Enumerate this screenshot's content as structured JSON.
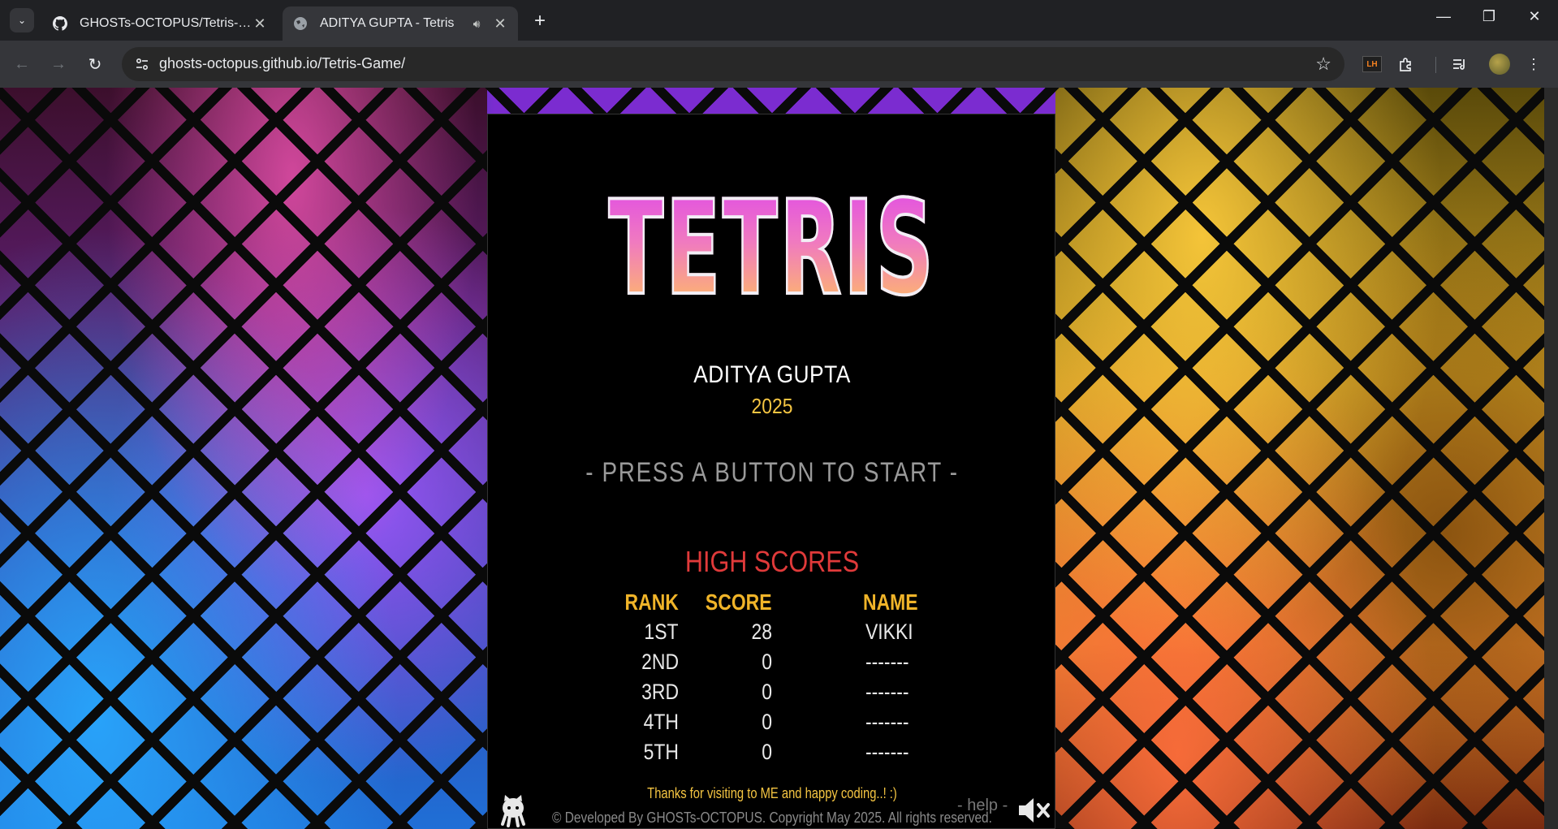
{
  "browser": {
    "tabs": [
      {
        "title": "GHOSTs-OCTOPUS/Tetris-Game",
        "favicon": "github-icon",
        "active": false
      },
      {
        "title": "ADITYA GUPTA - Tetris",
        "favicon": "globe-icon",
        "active": true,
        "audio": true
      }
    ],
    "url": "ghosts-octopus.github.io/Tetris-Game/",
    "lighthouse_label": "LH"
  },
  "game": {
    "title": "TETRIS",
    "author": "ADITYA GUPTA",
    "year": "2025",
    "prompt": "- PRESS A BUTTON TO START -",
    "high_scores": {
      "title": "HIGH SCORES",
      "headers": {
        "rank": "RANK",
        "score": "SCORE",
        "name": "NAME"
      },
      "rows": [
        {
          "rank": "1ST",
          "score": "28",
          "name": "VIKKI"
        },
        {
          "rank": "2ND",
          "score": "0",
          "name": "-------"
        },
        {
          "rank": "3RD",
          "score": "0",
          "name": "-------"
        },
        {
          "rank": "4TH",
          "score": "0",
          "name": "-------"
        },
        {
          "rank": "5TH",
          "score": "0",
          "name": "-------"
        }
      ]
    },
    "thanks": "Thanks for visiting to ME and happy coding..! :)",
    "copyright": "© Developed By GHOSTs-OCTOPUS. Copyright May 2025. All rights reserved.",
    "help": "- help -"
  },
  "colors": {
    "title_gradient_top": "#e04ce6",
    "title_gradient_bottom": "#ffc060",
    "accent_yellow": "#f5c542",
    "high_scores_red": "#e03a3a",
    "header_gold": "#f0b429"
  }
}
